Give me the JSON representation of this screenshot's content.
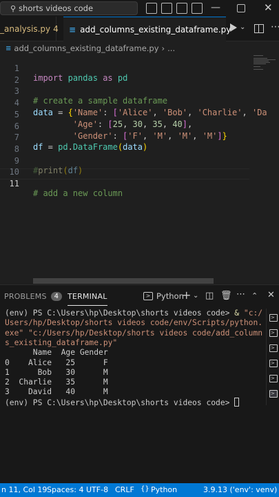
{
  "titlebar": {
    "search_text": "shorts videos code"
  },
  "tabs": [
    {
      "label": "_analysis.py",
      "problems": "4"
    },
    {
      "label": "add_columns_existing_dataframe.py"
    }
  ],
  "breadcrumb": {
    "file": "add_columns_existing_dataframe.py",
    "more": "..."
  },
  "editor": {
    "line_numbers": [
      "1",
      "2",
      "3",
      "4",
      "5",
      "6",
      "7",
      "8",
      "9",
      "10",
      "11"
    ],
    "active_line": "11"
  },
  "panel": {
    "problems_label": "PROBLEMS",
    "problems_count": "4",
    "terminal_label": "TERMINAL",
    "shell_name": "Python",
    "terminal_lines": [
      "(env) PS C:\\Users\\hp\\Desktop\\shorts videos code> & \"c:/",
      "Users/hp/Desktop/shorts videos code/env/Scripts/python.",
      "exe\" \"c:/Users/hp/Desktop/shorts videos code/add_column",
      "s_existing_dataframe.py\"",
      "      Name  Age Gender",
      "0    Alice   25      F",
      "1      Bob   30      M",
      "2  Charlie   35      M",
      "3    David   40      M",
      "(env) PS C:\\Users\\hp\\Desktop\\shorts videos code> "
    ]
  },
  "statusbar": {
    "position": "n 11, Col 19",
    "spaces": "Spaces: 4",
    "encoding": "UTF-8",
    "eol": "CRLF",
    "language": "Python",
    "interpreter": "3.9.13 ('env': venv)"
  },
  "colors": {
    "accent": "#0078d4",
    "background": "#1e1e1e"
  }
}
